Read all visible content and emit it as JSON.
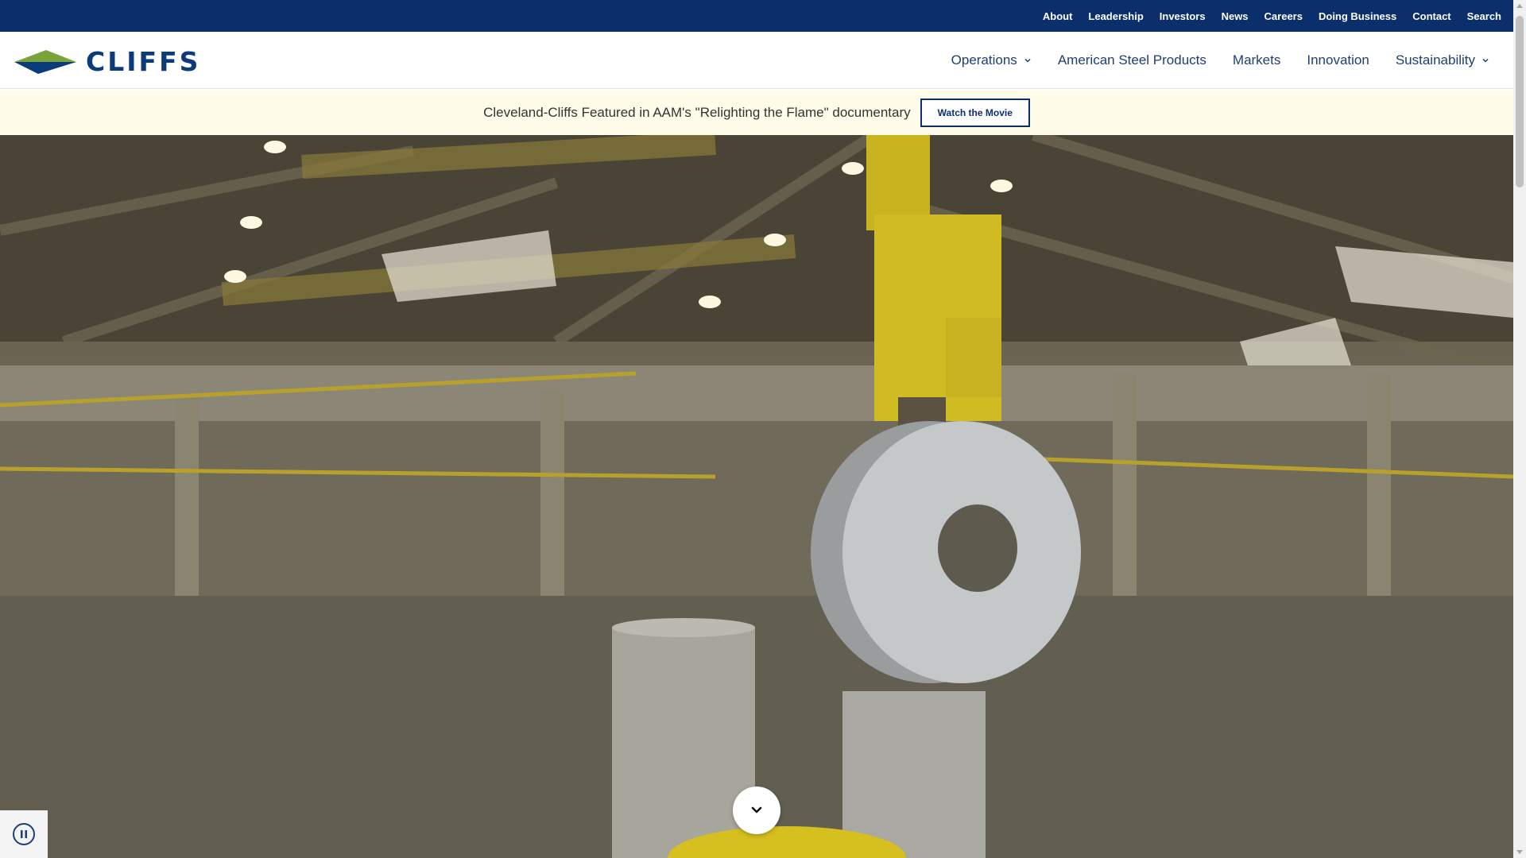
{
  "utility_nav": [
    "About",
    "Leadership",
    "Investors",
    "News",
    "Careers",
    "Doing Business",
    "Contact",
    "Search"
  ],
  "logo": {
    "text": "CLIFFS",
    "colors": {
      "blue": "#0b3b7a",
      "green": "#7aa33a"
    }
  },
  "main_nav": [
    {
      "label": "Operations",
      "has_dropdown": true
    },
    {
      "label": "American Steel Products",
      "has_dropdown": false
    },
    {
      "label": "Markets",
      "has_dropdown": false
    },
    {
      "label": "Innovation",
      "has_dropdown": false
    },
    {
      "label": "Sustainability",
      "has_dropdown": true
    }
  ],
  "banner": {
    "text": "Cleveland-Cliffs Featured in AAM's \"Relighting the Flame\" documentary",
    "button_label": "Watch the Movie"
  },
  "hero": {
    "content": "Steel mill video background",
    "controls": {
      "scroll_icon": "chevron-down-icon",
      "pause_icon": "pause-icon"
    }
  },
  "colors": {
    "utility_bar": "#0b2f6b",
    "nav_text": "#1d3f74",
    "banner_bg": "#fffdea"
  }
}
